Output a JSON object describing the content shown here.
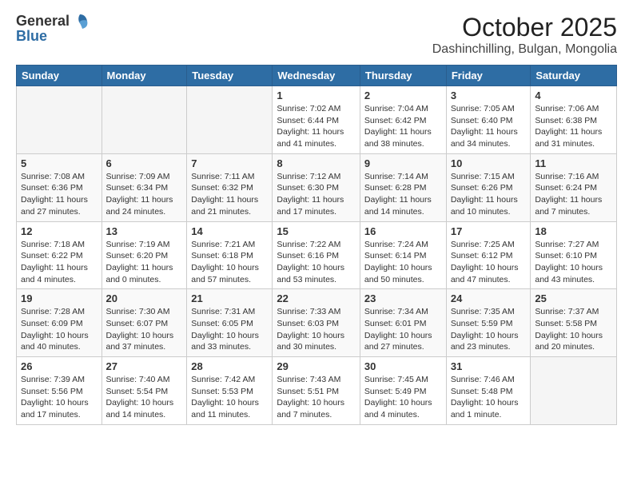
{
  "header": {
    "logo_general": "General",
    "logo_blue": "Blue",
    "month_title": "October 2025",
    "subtitle": "Dashinchilling, Bulgan, Mongolia"
  },
  "weekdays": [
    "Sunday",
    "Monday",
    "Tuesday",
    "Wednesday",
    "Thursday",
    "Friday",
    "Saturday"
  ],
  "weeks": [
    [
      {
        "num": "",
        "info": ""
      },
      {
        "num": "",
        "info": ""
      },
      {
        "num": "",
        "info": ""
      },
      {
        "num": "1",
        "info": "Sunrise: 7:02 AM\nSunset: 6:44 PM\nDaylight: 11 hours and 41 minutes."
      },
      {
        "num": "2",
        "info": "Sunrise: 7:04 AM\nSunset: 6:42 PM\nDaylight: 11 hours and 38 minutes."
      },
      {
        "num": "3",
        "info": "Sunrise: 7:05 AM\nSunset: 6:40 PM\nDaylight: 11 hours and 34 minutes."
      },
      {
        "num": "4",
        "info": "Sunrise: 7:06 AM\nSunset: 6:38 PM\nDaylight: 11 hours and 31 minutes."
      }
    ],
    [
      {
        "num": "5",
        "info": "Sunrise: 7:08 AM\nSunset: 6:36 PM\nDaylight: 11 hours and 27 minutes."
      },
      {
        "num": "6",
        "info": "Sunrise: 7:09 AM\nSunset: 6:34 PM\nDaylight: 11 hours and 24 minutes."
      },
      {
        "num": "7",
        "info": "Sunrise: 7:11 AM\nSunset: 6:32 PM\nDaylight: 11 hours and 21 minutes."
      },
      {
        "num": "8",
        "info": "Sunrise: 7:12 AM\nSunset: 6:30 PM\nDaylight: 11 hours and 17 minutes."
      },
      {
        "num": "9",
        "info": "Sunrise: 7:14 AM\nSunset: 6:28 PM\nDaylight: 11 hours and 14 minutes."
      },
      {
        "num": "10",
        "info": "Sunrise: 7:15 AM\nSunset: 6:26 PM\nDaylight: 11 hours and 10 minutes."
      },
      {
        "num": "11",
        "info": "Sunrise: 7:16 AM\nSunset: 6:24 PM\nDaylight: 11 hours and 7 minutes."
      }
    ],
    [
      {
        "num": "12",
        "info": "Sunrise: 7:18 AM\nSunset: 6:22 PM\nDaylight: 11 hours and 4 minutes."
      },
      {
        "num": "13",
        "info": "Sunrise: 7:19 AM\nSunset: 6:20 PM\nDaylight: 11 hours and 0 minutes."
      },
      {
        "num": "14",
        "info": "Sunrise: 7:21 AM\nSunset: 6:18 PM\nDaylight: 10 hours and 57 minutes."
      },
      {
        "num": "15",
        "info": "Sunrise: 7:22 AM\nSunset: 6:16 PM\nDaylight: 10 hours and 53 minutes."
      },
      {
        "num": "16",
        "info": "Sunrise: 7:24 AM\nSunset: 6:14 PM\nDaylight: 10 hours and 50 minutes."
      },
      {
        "num": "17",
        "info": "Sunrise: 7:25 AM\nSunset: 6:12 PM\nDaylight: 10 hours and 47 minutes."
      },
      {
        "num": "18",
        "info": "Sunrise: 7:27 AM\nSunset: 6:10 PM\nDaylight: 10 hours and 43 minutes."
      }
    ],
    [
      {
        "num": "19",
        "info": "Sunrise: 7:28 AM\nSunset: 6:09 PM\nDaylight: 10 hours and 40 minutes."
      },
      {
        "num": "20",
        "info": "Sunrise: 7:30 AM\nSunset: 6:07 PM\nDaylight: 10 hours and 37 minutes."
      },
      {
        "num": "21",
        "info": "Sunrise: 7:31 AM\nSunset: 6:05 PM\nDaylight: 10 hours and 33 minutes."
      },
      {
        "num": "22",
        "info": "Sunrise: 7:33 AM\nSunset: 6:03 PM\nDaylight: 10 hours and 30 minutes."
      },
      {
        "num": "23",
        "info": "Sunrise: 7:34 AM\nSunset: 6:01 PM\nDaylight: 10 hours and 27 minutes."
      },
      {
        "num": "24",
        "info": "Sunrise: 7:35 AM\nSunset: 5:59 PM\nDaylight: 10 hours and 23 minutes."
      },
      {
        "num": "25",
        "info": "Sunrise: 7:37 AM\nSunset: 5:58 PM\nDaylight: 10 hours and 20 minutes."
      }
    ],
    [
      {
        "num": "26",
        "info": "Sunrise: 7:39 AM\nSunset: 5:56 PM\nDaylight: 10 hours and 17 minutes."
      },
      {
        "num": "27",
        "info": "Sunrise: 7:40 AM\nSunset: 5:54 PM\nDaylight: 10 hours and 14 minutes."
      },
      {
        "num": "28",
        "info": "Sunrise: 7:42 AM\nSunset: 5:53 PM\nDaylight: 10 hours and 11 minutes."
      },
      {
        "num": "29",
        "info": "Sunrise: 7:43 AM\nSunset: 5:51 PM\nDaylight: 10 hours and 7 minutes."
      },
      {
        "num": "30",
        "info": "Sunrise: 7:45 AM\nSunset: 5:49 PM\nDaylight: 10 hours and 4 minutes."
      },
      {
        "num": "31",
        "info": "Sunrise: 7:46 AM\nSunset: 5:48 PM\nDaylight: 10 hours and 1 minute."
      },
      {
        "num": "",
        "info": ""
      }
    ]
  ]
}
